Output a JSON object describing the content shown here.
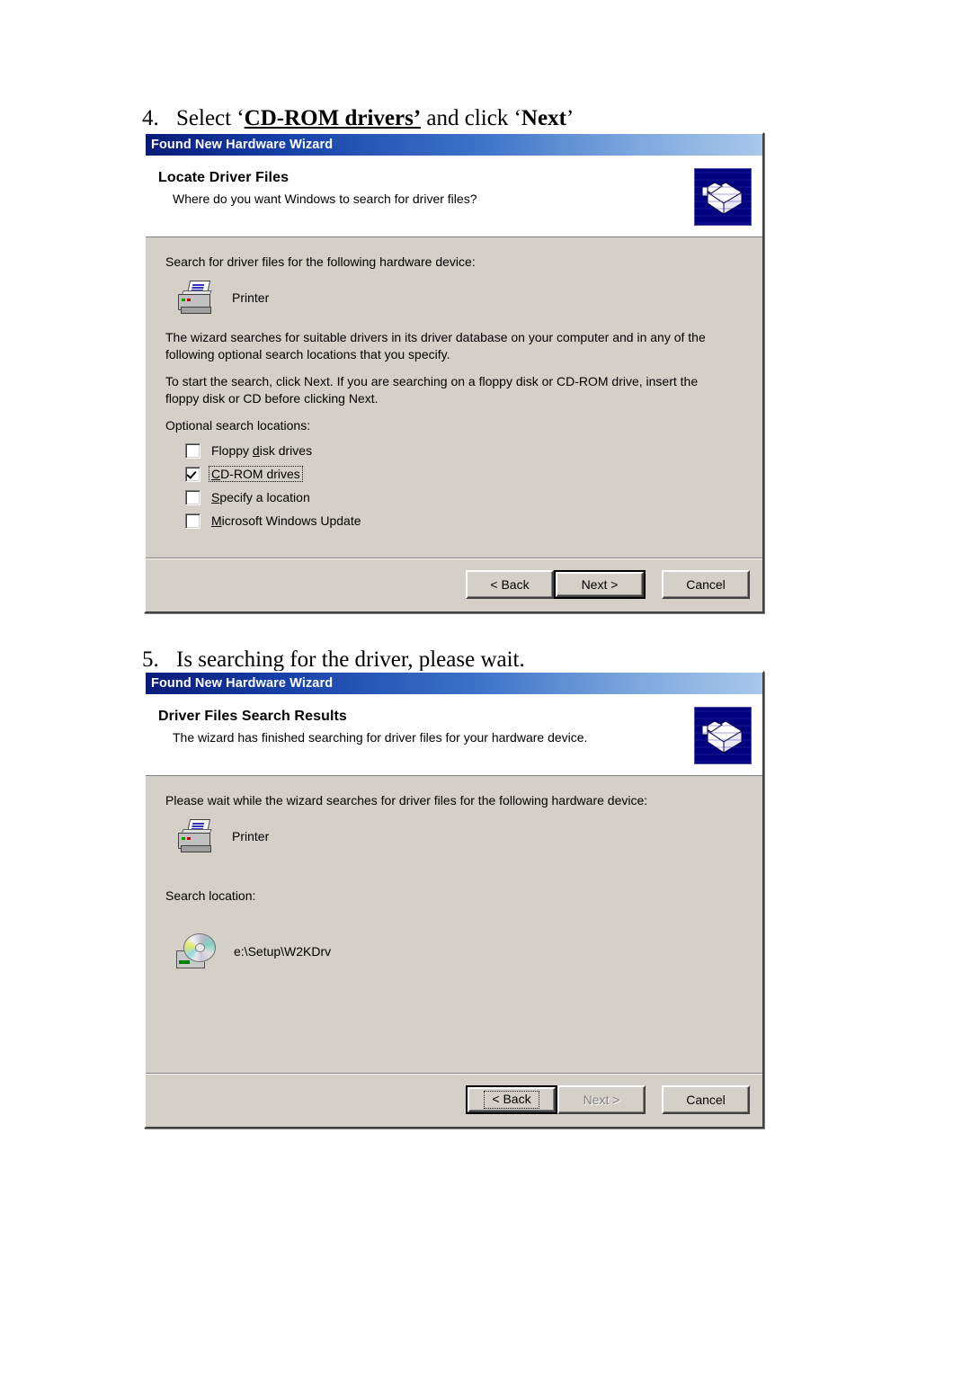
{
  "steps": [
    {
      "number": "4.",
      "parts": [
        {
          "text": "Select ‘",
          "style": "normal"
        },
        {
          "text": "CD-ROM drivers’",
          "style": "bold-underline"
        },
        {
          "text": " and click ‘",
          "style": "normal"
        },
        {
          "text": "Next",
          "style": "bold"
        },
        {
          "text": "’",
          "style": "normal"
        }
      ],
      "plain": "4. Select ‘CD-ROM drivers’ and click ‘Next’"
    },
    {
      "number": "5.",
      "plain": "5. Is searching for the driver, please wait.",
      "text": "Is searching for the driver, please wait."
    }
  ],
  "dialog1": {
    "titlebar": "Found New Hardware Wizard",
    "header_title": "Locate Driver Files",
    "header_subtitle": "Where do you want Windows to search for driver files?",
    "wizard_icon": "hardware-box-icon",
    "intro": "Search for driver files for the following hardware device:",
    "device_icon": "printer-icon",
    "device_label": "Printer",
    "paragraph1": "The wizard searches for suitable drivers in its driver database on your computer and in any of the following optional search locations that you specify.",
    "paragraph2": "To start the search, click Next. If you are searching on a floppy disk or CD-ROM drive, insert the floppy disk or CD before clicking Next.",
    "options_label": "Optional search locations:",
    "checkboxes": [
      {
        "label": "Floppy disk drives",
        "accel": "d",
        "checked": false,
        "focused": false
      },
      {
        "label": "CD-ROM drives",
        "accel": "C",
        "checked": true,
        "focused": true
      },
      {
        "label": "Specify a location",
        "accel": "S",
        "checked": false,
        "focused": false
      },
      {
        "label": "Microsoft Windows Update",
        "accel": "M",
        "checked": false,
        "focused": false
      }
    ],
    "buttons": {
      "back": "< Back",
      "next": "Next >",
      "cancel": "Cancel",
      "default": "next",
      "next_disabled": false,
      "back_disabled": false
    }
  },
  "dialog2": {
    "titlebar": "Found New Hardware Wizard",
    "header_title": "Driver Files Search Results",
    "header_subtitle": "The wizard has finished searching for driver files for your hardware device.",
    "wizard_icon": "hardware-box-icon",
    "intro": "Please wait while the wizard searches for driver files for the following hardware device:",
    "device_icon": "printer-icon",
    "device_label": "Printer",
    "location_label": "Search location:",
    "location_icon": "cd-drive-icon",
    "location_value": "e:\\Setup\\W2KDrv",
    "buttons": {
      "back": "< Back",
      "next": "Next >",
      "cancel": "Cancel",
      "default": "back",
      "next_disabled": true,
      "back_disabled": false
    }
  },
  "colors": {
    "titlebar_dark": "#0a1a78",
    "titlebar_light": "#a8c8ec",
    "dialog_face": "#d4d0c8",
    "header_bg": "#ffffff",
    "wizard_icon_bg": "#000080",
    "disabled_text": "#808080"
  }
}
